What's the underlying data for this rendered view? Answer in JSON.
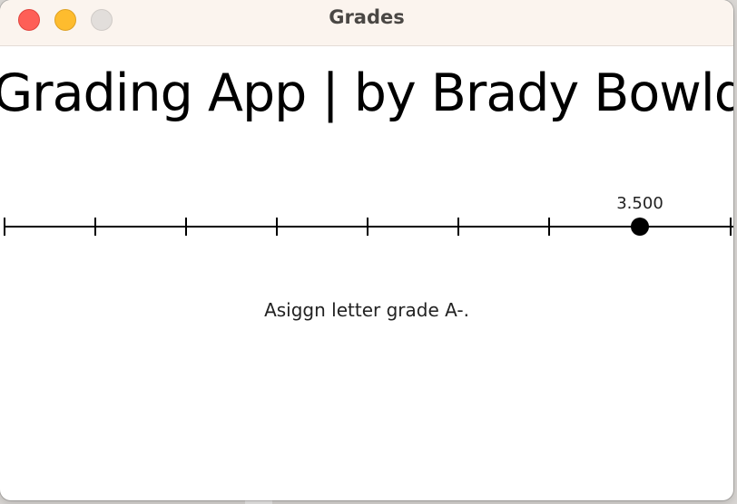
{
  "window": {
    "title": "Grades",
    "controls": [
      "close",
      "minimize",
      "maximize"
    ]
  },
  "app": {
    "heading": "Grading App | by Brady Bowlden"
  },
  "slider": {
    "value_label": "3.500",
    "value": 3.5,
    "min": 0.0,
    "max": 4.0
  },
  "status": {
    "message": "Asiggn letter grade A-."
  }
}
